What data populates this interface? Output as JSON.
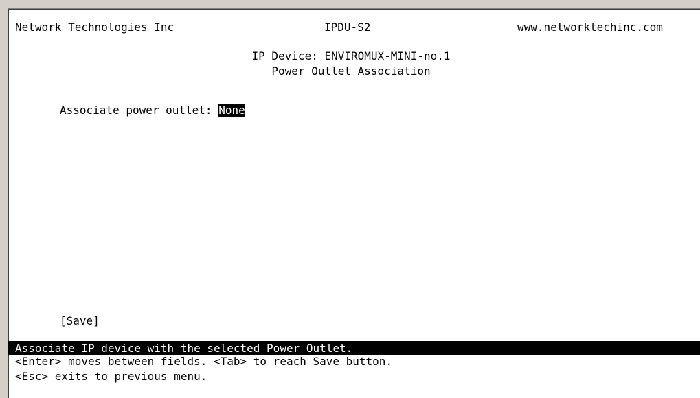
{
  "header": {
    "company": "Network Technologies Inc",
    "product": "IPDU-S2",
    "website": "www.networktechinc.com"
  },
  "title": {
    "line1": "IP Device: ENVIROMUX-MINI-no.1",
    "line2": "Power Outlet Association"
  },
  "form": {
    "field_label": "Associate power outlet: ",
    "field_value": "None"
  },
  "buttons": {
    "save": "[Save]"
  },
  "status": {
    "message": "Associate IP device with the selected Power Outlet."
  },
  "help": {
    "line1": "<Enter> moves between fields. <Tab> to reach Save button.",
    "line2": "<Esc> exits to previous menu."
  },
  "colors": {
    "background": "#ffffff",
    "text": "#000000",
    "highlight_bg": "#000000",
    "highlight_fg": "#ffffff"
  }
}
